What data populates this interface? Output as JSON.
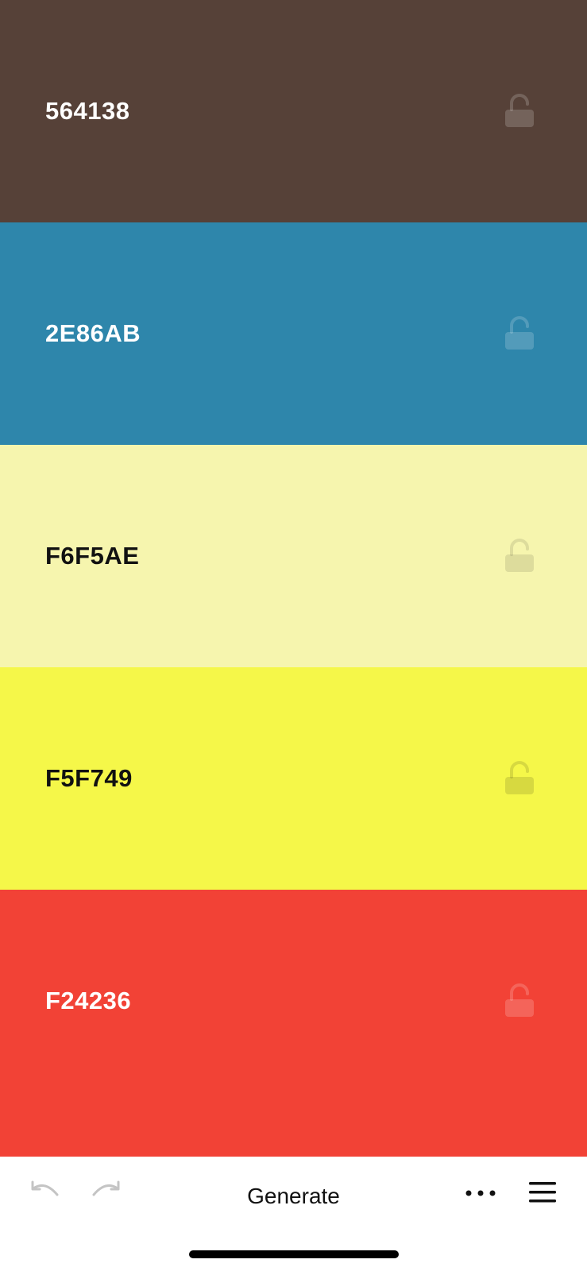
{
  "palette": {
    "colors": [
      {
        "hex": "564138",
        "bg": "#564138",
        "text_tone": "light",
        "lock": "unlocked",
        "lock_color": "rgba(255,255,255,0.18)"
      },
      {
        "hex": "2E86AB",
        "bg": "#2E86AB",
        "text_tone": "light",
        "lock": "unlocked",
        "lock_color": "rgba(255,255,255,0.18)"
      },
      {
        "hex": "F6F5AE",
        "bg": "#F6F5AE",
        "text_tone": "dark",
        "lock": "unlocked",
        "lock_color": "rgba(0,0,0,0.10)"
      },
      {
        "hex": "F5F749",
        "bg": "#F5F749",
        "text_tone": "dark",
        "lock": "unlocked",
        "lock_color": "rgba(0,0,0,0.12)"
      },
      {
        "hex": "F24236",
        "bg": "#F24236",
        "text_tone": "light",
        "lock": "unlocked",
        "lock_color": "rgba(255,255,255,0.18)"
      }
    ]
  },
  "toolbar": {
    "undo_icon": "undo-arrow",
    "redo_icon": "redo-arrow",
    "generate_label": "Generate",
    "more_icon": "more-horizontal",
    "menu_icon": "hamburger-menu"
  }
}
